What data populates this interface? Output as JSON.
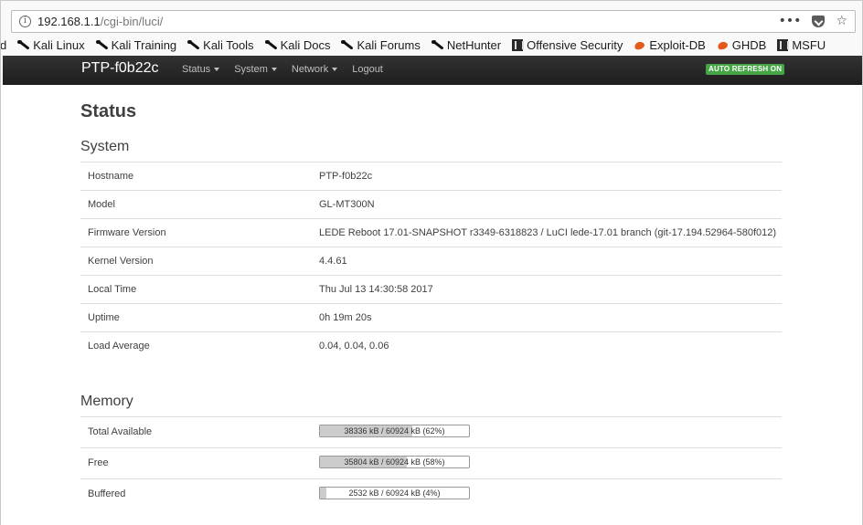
{
  "browser": {
    "url_host": "192.168.1.1",
    "url_path": "/cgi-bin/luci/",
    "actions": {
      "more": "•••",
      "star": "☆"
    }
  },
  "bookmarks": {
    "cut_item": "d",
    "items": [
      {
        "label": "Kali Linux",
        "icon": "kali-dragon-icon"
      },
      {
        "label": "Kali Training",
        "icon": "kali-dragon-icon"
      },
      {
        "label": "Kali Tools",
        "icon": "kali-dragon-icon"
      },
      {
        "label": "Kali Docs",
        "icon": "kali-dragon-icon"
      },
      {
        "label": "Kali Forums",
        "icon": "kali-dragon-icon"
      },
      {
        "label": "NetHunter",
        "icon": "kali-dragon-icon"
      },
      {
        "label": "Offensive Security",
        "icon": "offsec-icon"
      },
      {
        "label": "Exploit-DB",
        "icon": "exploitdb-flame-icon"
      },
      {
        "label": "GHDB",
        "icon": "exploitdb-flame-icon"
      },
      {
        "label": "MSFU",
        "icon": "msfu-icon"
      }
    ]
  },
  "header": {
    "brand": "PTP-f0b22c",
    "menu": [
      "Status",
      "System",
      "Network"
    ],
    "logout": "Logout",
    "auto_refresh": "AUTO REFRESH ON",
    "colors": {
      "navbar": "#222222",
      "badge": "#46a546"
    }
  },
  "main": {
    "title": "Status",
    "system": {
      "heading": "System",
      "rows": [
        {
          "label": "Hostname",
          "value": "PTP-f0b22c"
        },
        {
          "label": "Model",
          "value": "GL-MT300N"
        },
        {
          "label": "Firmware Version",
          "value": "LEDE Reboot 17.01-SNAPSHOT r3349-6318823 / LuCI lede-17.01 branch (git-17.194.52964-580f012)"
        },
        {
          "label": "Kernel Version",
          "value": "4.4.61"
        },
        {
          "label": "Local Time",
          "value": "Thu Jul 13 14:30:58 2017"
        },
        {
          "label": "Uptime",
          "value": "0h 19m 20s"
        },
        {
          "label": "Load Average",
          "value": "0.04, 0.04, 0.06"
        }
      ]
    },
    "memory": {
      "heading": "Memory",
      "rows": [
        {
          "label": "Total Available",
          "text": "38336 kB / 60924 kB (62%)",
          "percent": 62
        },
        {
          "label": "Free",
          "text": "35804 kB / 60924 kB (58%)",
          "percent": 58
        },
        {
          "label": "Buffered",
          "text": "2532 kB / 60924 kB (4%)",
          "percent": 4
        }
      ]
    }
  }
}
